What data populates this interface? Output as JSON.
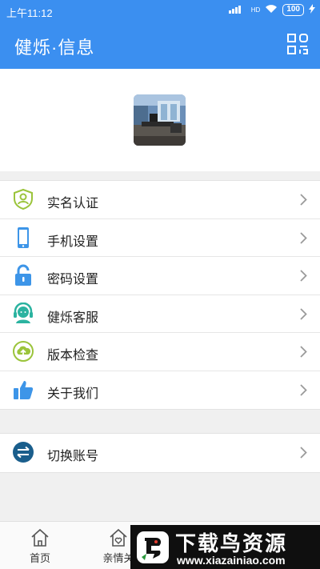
{
  "status_bar": {
    "time": "上午11:12",
    "network": "HD",
    "battery": "100"
  },
  "app_bar": {
    "title": "健烁·信息",
    "qr_icon": "qr-code-icon"
  },
  "profile": {
    "avatar_icon": "office-photo-avatar"
  },
  "menu_group_1": [
    {
      "label": "实名认证",
      "icon": "shield-user-icon",
      "color": "#9bc43b"
    },
    {
      "label": "手机设置",
      "icon": "phone-icon",
      "color": "#3d95e8"
    },
    {
      "label": "密码设置",
      "icon": "lock-icon",
      "color": "#3d95e8"
    },
    {
      "label": "健烁客服",
      "icon": "headset-icon",
      "color": "#2bb3a0"
    },
    {
      "label": "版本检查",
      "icon": "cloud-upload-icon",
      "color": "#9bc43b"
    },
    {
      "label": "关于我们",
      "icon": "thumbs-up-icon",
      "color": "#3d95e8"
    }
  ],
  "menu_group_2": [
    {
      "label": "切换账号",
      "icon": "switch-account-icon",
      "color": "#1a5e8c"
    }
  ],
  "tab_bar": [
    {
      "label": "首页",
      "icon": "home-icon"
    },
    {
      "label": "亲情关",
      "icon": "family-icon"
    }
  ],
  "watermark": {
    "title": "下载鸟资源",
    "url": "www.xiazainiao.com"
  }
}
